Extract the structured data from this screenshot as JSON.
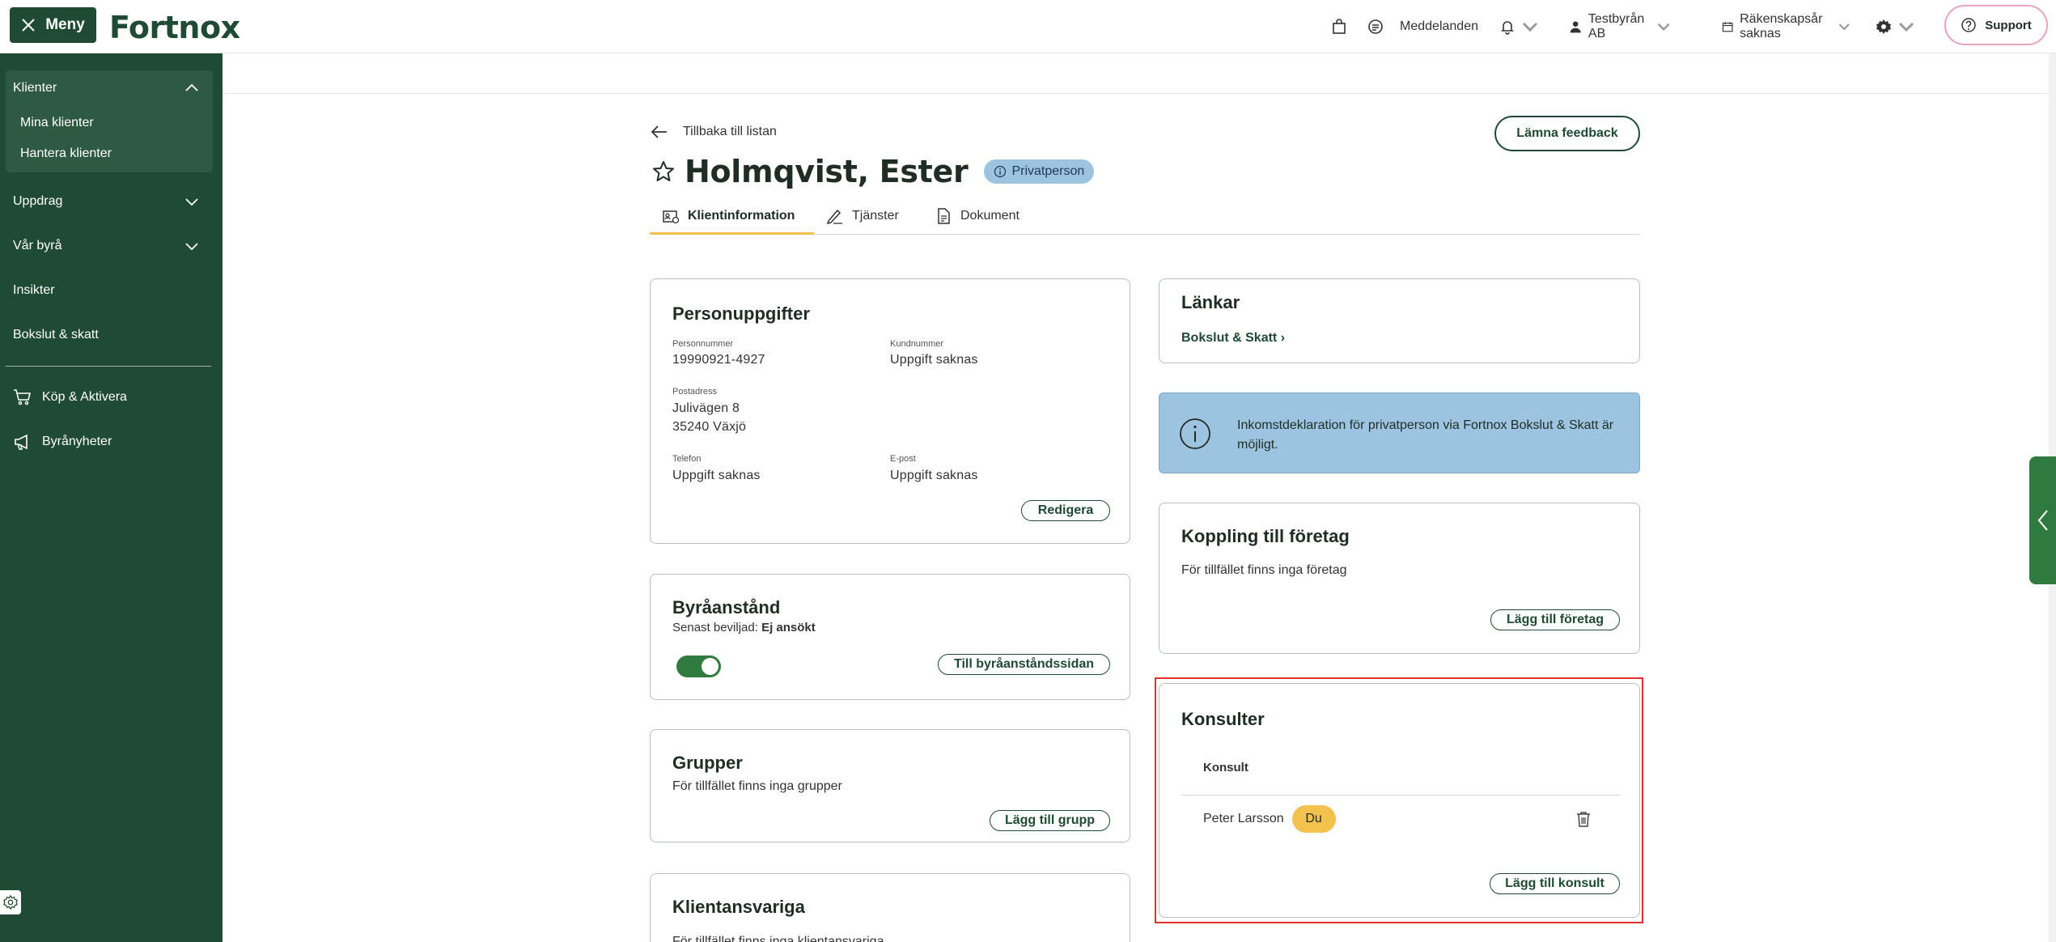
{
  "topbar": {
    "menu_label": "Meny",
    "logo_text": "Fortnox",
    "messages_label": "Meddelanden",
    "company_label": "Testbyrån AB",
    "fiscal_year_label": "Räkenskapsår saknas",
    "support_label": "Support"
  },
  "sidebar": {
    "groups": [
      {
        "label": "Klienter",
        "expanded": true,
        "children": [
          "Mina klienter",
          "Hantera klienter"
        ]
      },
      {
        "label": "Uppdrag",
        "expanded": false
      },
      {
        "label": "Vår byrå",
        "expanded": false
      }
    ],
    "items": [
      "Insikter",
      "Bokslut & skatt"
    ],
    "bottom_items": [
      "Köp & Aktivera",
      "Byrånyheter"
    ]
  },
  "header": {
    "back_label": "Tillbaka till listan",
    "feedback_label": "Lämna feedback",
    "title": "Holmqvist, Ester",
    "badge": "Privatperson",
    "tabs": [
      "Klientinformation",
      "Tjänster",
      "Dokument"
    ]
  },
  "personuppgifter": {
    "title": "Personuppgifter",
    "personnummer_label": "Personnummer",
    "personnummer": "19990921-4927",
    "kundnummer_label": "Kundnummer",
    "kundnummer": "Uppgift saknas",
    "postadress_label": "Postadress",
    "address_line1": "Julivägen 8",
    "address_line2": "35240 Växjö",
    "telefon_label": "Telefon",
    "telefon": "Uppgift saknas",
    "epost_label": "E-post",
    "epost": "Uppgift saknas",
    "edit_label": "Redigera"
  },
  "byraanstand": {
    "title": "Byråanstånd",
    "granted_prefix": "Senast beviljad:",
    "granted_value": "Ej ansökt",
    "button_label": "Till byråanståndssidan",
    "toggle_on": true
  },
  "grupper": {
    "title": "Grupper",
    "empty_text": "För tillfället finns inga grupper",
    "button_label": "Lägg till grupp"
  },
  "klientansvariga": {
    "title": "Klientansvariga",
    "empty_text": "För tillfället finns inga klientansvariga"
  },
  "lankar": {
    "title": "Länkar",
    "link_label": "Bokslut & Skatt ›"
  },
  "info": {
    "text": "Inkomstdeklaration för privatperson via Fortnox Bokslut & Skatt är möjligt."
  },
  "koppling": {
    "title": "Koppling till företag",
    "empty_text": "För tillfället finns inga företag",
    "button_label": "Lägg till företag"
  },
  "konsulter": {
    "title": "Konsulter",
    "column_header": "Konsult",
    "rows": [
      {
        "name": "Peter Larsson",
        "badge": "Du"
      }
    ],
    "button_label": "Lägg till konsult"
  },
  "colors": {
    "brand_green": "#1f4a33",
    "accent_yellow": "#f2c14e",
    "info_blue": "#9cc3e0",
    "highlight_red": "#e0302f"
  }
}
